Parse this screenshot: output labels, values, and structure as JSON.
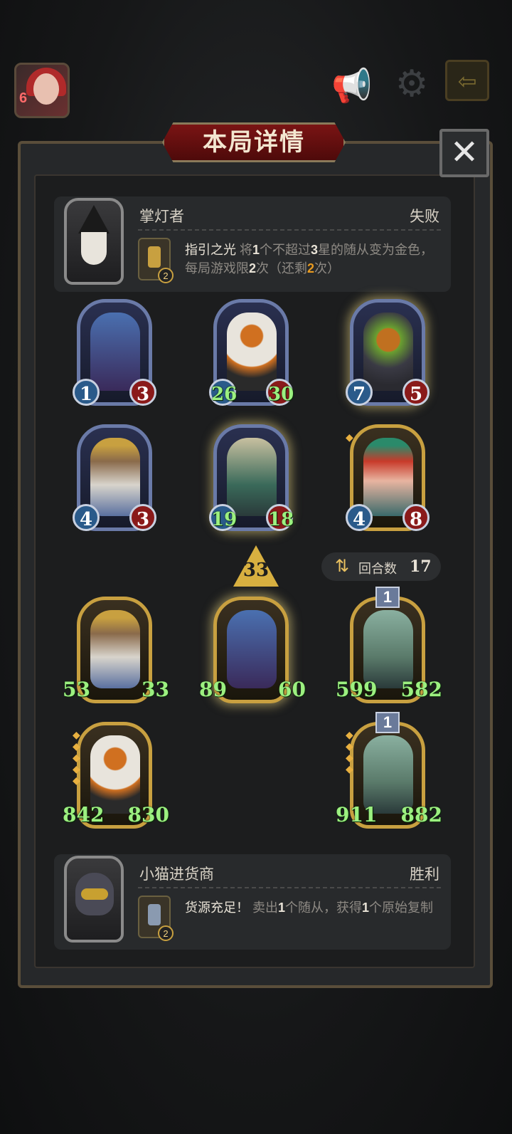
{
  "header": {
    "player_level": "6",
    "title": "本局详情",
    "close_label": "✕"
  },
  "top_player": {
    "name": "掌灯者",
    "result": "失败",
    "skill_charges": "2",
    "skill_name": "指引之光",
    "skill_desc": {
      "p1": " 将",
      "n1": "1",
      "p2": "个不超过",
      "n2": "3",
      "p3": "星的随从变为金色，每局游戏限",
      "n3": "2",
      "p4": "次（还剩",
      "n4": "2",
      "p5": "次）"
    }
  },
  "top_board": [
    {
      "atk": "1",
      "hp": "3"
    },
    {
      "atk": "26",
      "hp": "30"
    },
    {
      "atk": "7",
      "hp": "5"
    },
    {
      "atk": "4",
      "hp": "3"
    },
    {
      "atk": "19",
      "hp": "18"
    },
    {
      "atk": "4",
      "hp": "8"
    }
  ],
  "damage": "33",
  "rounds": {
    "label": "回合数",
    "value": "17"
  },
  "bottom_board": [
    {
      "atk": "53",
      "hp": "33"
    },
    {
      "atk": "89",
      "hp": "60"
    },
    {
      "atk": "599",
      "hp": "582",
      "tier": "1"
    },
    {
      "atk": "842",
      "hp": "830"
    },
    {
      "atk": "911",
      "hp": "882",
      "tier": "1"
    }
  ],
  "bottom_player": {
    "name": "小猫进货商",
    "result": "胜利",
    "skill_charges": "2",
    "skill_name": "货源充足！",
    "skill_desc": {
      "p1": " 卖出",
      "n1": "1",
      "p2": "个随从，获得",
      "n2": "1",
      "p3": "个原始复制"
    }
  }
}
